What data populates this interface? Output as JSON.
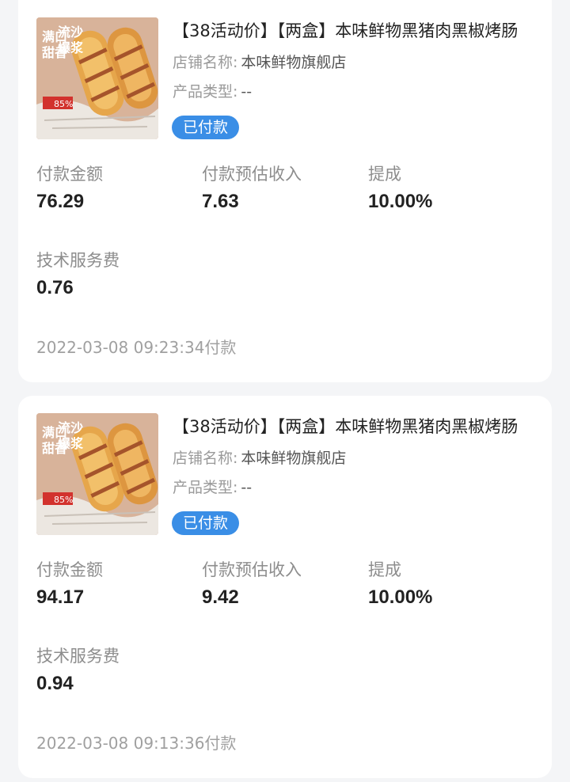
{
  "orders": [
    {
      "title": "【38活动价】【两盒】本味鲜物黑猪肉黑椒烤肠",
      "shop_label": "店铺名称:",
      "shop_name": "本味鲜物旗舰店",
      "type_label": "产品类型:",
      "type_value": "--",
      "status": "已付款",
      "thumb_text": [
        "流沙",
        "爆浆",
        "满口",
        "甜香"
      ],
      "thumb_badge": "85%",
      "metrics": {
        "pay_amount_label": "付款金额",
        "pay_amount": "76.29",
        "est_income_label": "付款预估收入",
        "est_income": "7.63",
        "commission_label": "提成",
        "commission": "10.00%",
        "service_fee_label": "技术服务费",
        "service_fee": "0.76"
      },
      "paid_time": "2022-03-08 09:23:34付款"
    },
    {
      "title": "【38活动价】【两盒】本味鲜物黑猪肉黑椒烤肠",
      "shop_label": "店铺名称:",
      "shop_name": "本味鲜物旗舰店",
      "type_label": "产品类型:",
      "type_value": "--",
      "status": "已付款",
      "thumb_text": [
        "流沙",
        "爆浆",
        "满口",
        "甜香"
      ],
      "thumb_badge": "85%",
      "metrics": {
        "pay_amount_label": "付款金额",
        "pay_amount": "94.17",
        "est_income_label": "付款预估收入",
        "est_income": "9.42",
        "commission_label": "提成",
        "commission": "10.00%",
        "service_fee_label": "技术服务费",
        "service_fee": "0.94"
      },
      "paid_time": "2022-03-08 09:13:36付款"
    }
  ],
  "colors": {
    "badge_bg": "#3a8ee6",
    "page_bg": "#f4f5f7",
    "thumb_text": "#ffffff",
    "thumb_badge": "#d2322d"
  }
}
